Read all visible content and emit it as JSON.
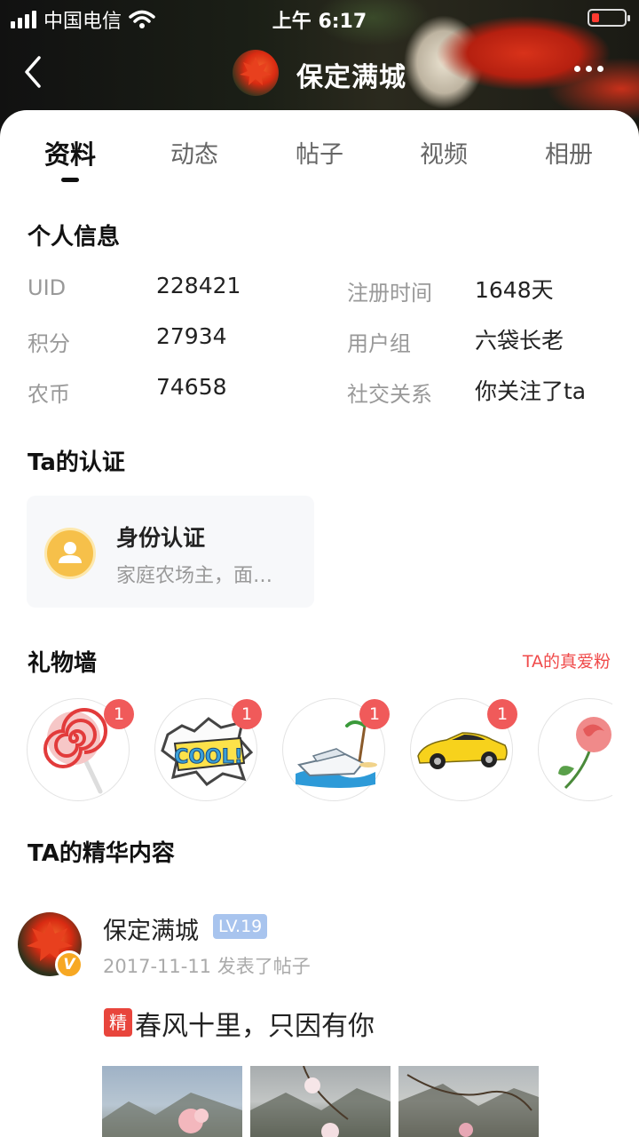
{
  "status_bar": {
    "carrier": "中国电信",
    "time": "上午 6:17"
  },
  "nav": {
    "title": "保定满城"
  },
  "tabs": [
    {
      "label": "资料",
      "active": true
    },
    {
      "label": "动态",
      "active": false
    },
    {
      "label": "帖子",
      "active": false
    },
    {
      "label": "视频",
      "active": false
    },
    {
      "label": "相册",
      "active": false
    }
  ],
  "personal_info": {
    "title": "个人信息",
    "rows": [
      {
        "label": "UID",
        "value": "228421"
      },
      {
        "label": "积分",
        "value": "27934"
      },
      {
        "label": "农币",
        "value": "74658"
      },
      {
        "label": "注册时间",
        "value": "1648天"
      },
      {
        "label": "用户组",
        "value": "六袋长老"
      },
      {
        "label": "社交关系",
        "value": "你关注了ta"
      }
    ]
  },
  "certification": {
    "title": "Ta的认证",
    "card_title": "身份认证",
    "card_desc": "家庭农场主，面…"
  },
  "gift_wall": {
    "title": "礼物墙",
    "link": "TA的真爱粉",
    "gifts": [
      {
        "name": "lollipop",
        "count": "1"
      },
      {
        "name": "cool-sticker",
        "count": "1"
      },
      {
        "name": "yacht",
        "count": "1"
      },
      {
        "name": "sports-car",
        "count": "1"
      },
      {
        "name": "rose",
        "count": ""
      }
    ]
  },
  "featured": {
    "title": "TA的精华内容",
    "post": {
      "author": "保定满城",
      "level": "LV.19",
      "meta": "2017-11-11 发表了帖子",
      "tag": "精",
      "title": "春风十里，只因有你"
    }
  },
  "colors": {
    "accent_red": "#f05a5a",
    "level_badge": "#a8c4ee",
    "verified": "#f7a823"
  }
}
